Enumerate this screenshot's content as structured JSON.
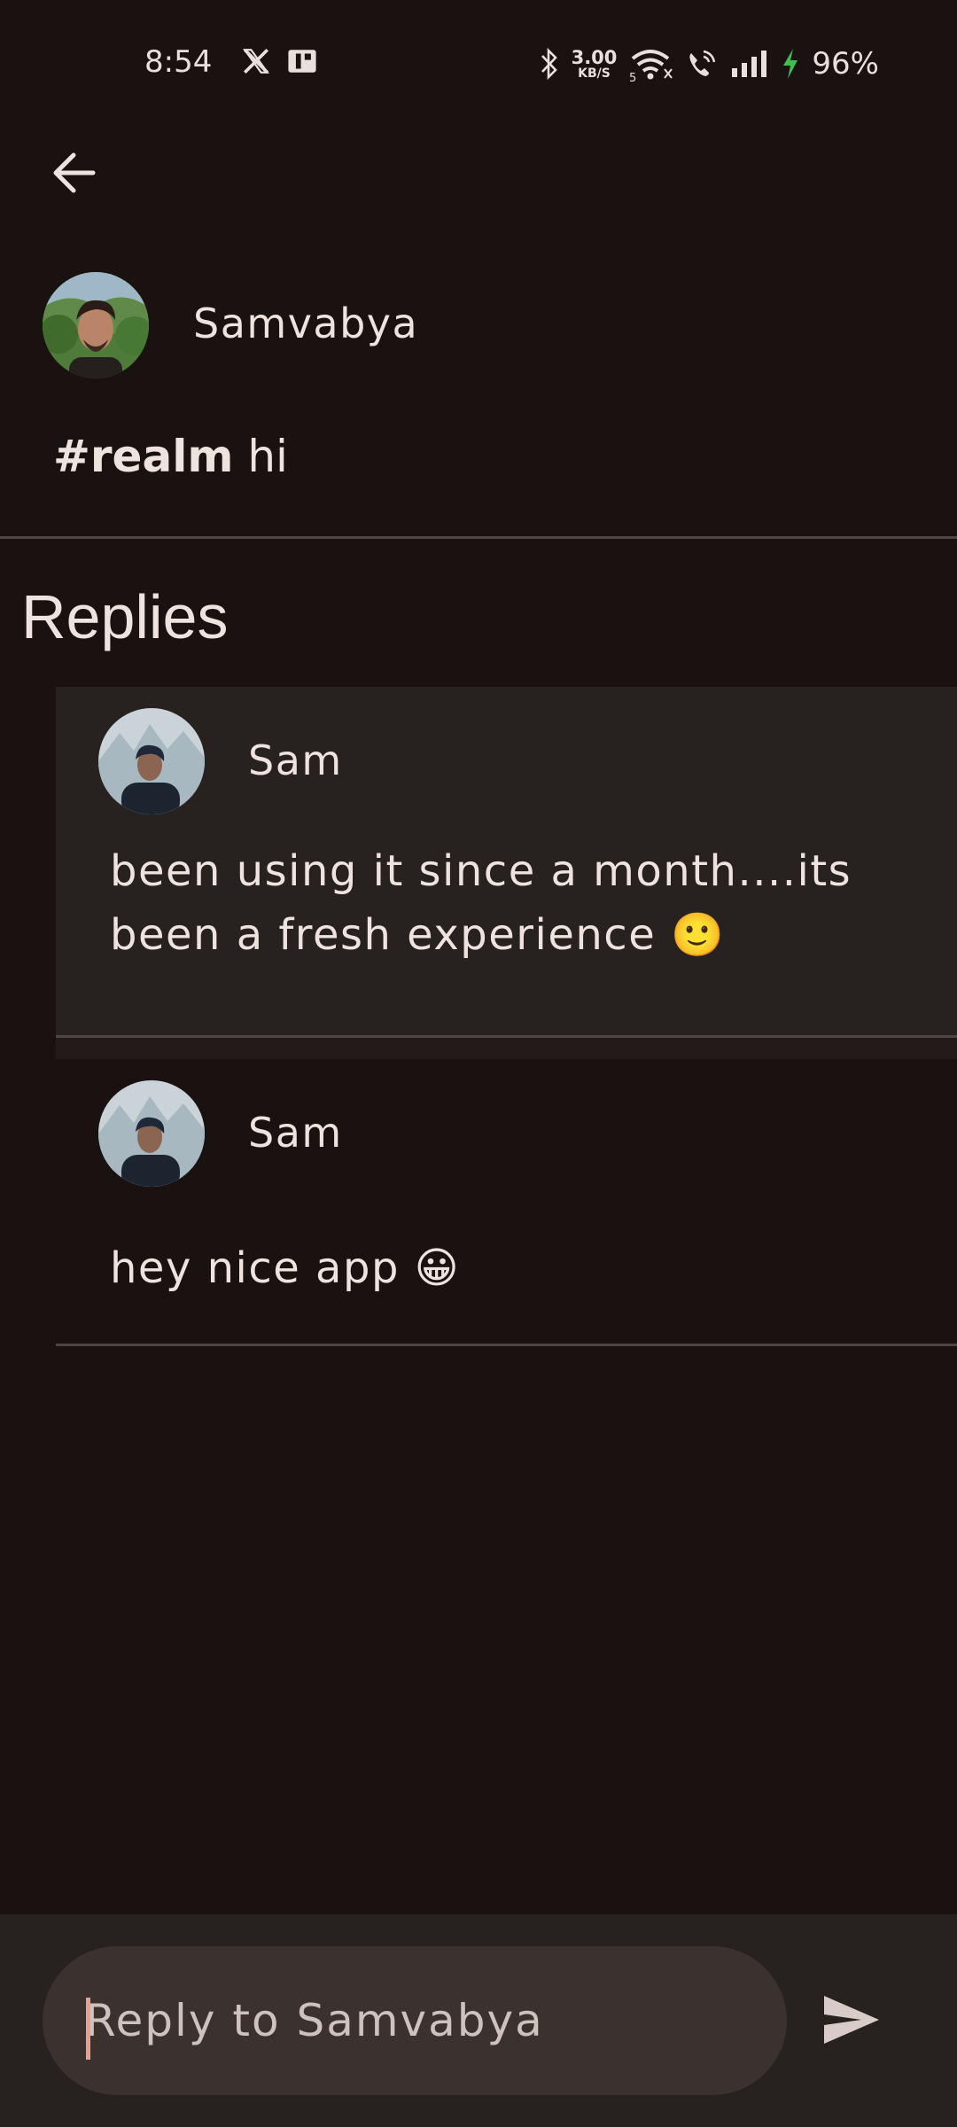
{
  "status_bar": {
    "time": "8:54",
    "network_speed_value": "3.00",
    "network_speed_unit": "KB/S",
    "battery": "96%",
    "icons": [
      "x-icon",
      "app-notification-icon",
      "bluetooth-icon",
      "wifi-icon",
      "wifi-calling-icon",
      "signal-icon",
      "charging-icon"
    ]
  },
  "post": {
    "author": "Samvabya",
    "hashtag": "#realm",
    "text": " hi"
  },
  "replies": {
    "title": "Replies",
    "items": [
      {
        "author": "Sam",
        "text": "been using it since a month....its been a fresh experience 🙂"
      },
      {
        "author": "Sam",
        "text": "hey nice app 😀"
      }
    ]
  },
  "composer": {
    "placeholder": "Reply to Samvabya",
    "send_icon": "send-icon"
  },
  "colors": {
    "background": "#1a1211",
    "reply_highlight": "#272120",
    "input_background": "#3b3230",
    "text": "#efe3df",
    "caret": "#e7a08e",
    "charging": "#3fbf4f"
  }
}
